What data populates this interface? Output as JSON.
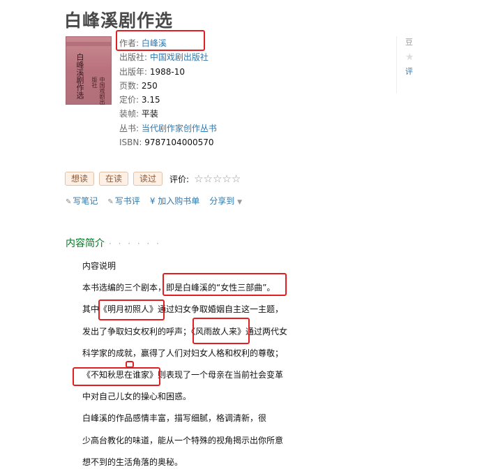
{
  "book": {
    "title": "白峰溪剧作选",
    "cover": {
      "title": "白峰溪剧作选",
      "subtitle": "中国戏剧出版社"
    },
    "info": [
      {
        "label": "作者:",
        "value": "白峰溪",
        "link": true
      },
      {
        "label": "出版社:",
        "value": "中国戏剧出版社",
        "link": true
      },
      {
        "label": "出版年:",
        "value": "1988-10",
        "link": false
      },
      {
        "label": "页数:",
        "value": "250",
        "link": false
      },
      {
        "label": "定价:",
        "value": "3.15",
        "link": false
      },
      {
        "label": "装帧:",
        "value": "平装",
        "link": false
      },
      {
        "label": "丛书:",
        "value": "当代剧作家创作丛书",
        "link": true
      },
      {
        "label": "ISBN:",
        "value": "9787104000570",
        "link": false
      }
    ]
  },
  "sidebar": {
    "label_top": "豆",
    "label_bottom": "评"
  },
  "actions": {
    "want": "想读",
    "reading": "在读",
    "read": "读过",
    "rating_label": "评价:",
    "stars": "☆☆☆☆☆"
  },
  "links": {
    "note": "写笔记",
    "review": "写书评",
    "cart": "¥ 加入购书单",
    "share": "分享到"
  },
  "content": {
    "heading": "内容简介",
    "dots": "· · · · · ·",
    "lines": [
      "内容说明",
      "本书选编的三个剧本，即是白峰溪的“女性三部曲”。",
      "其中《明月初照人》通过妇女争取婚姻自主这一主题，",
      "发出了争取妇女权利的呼声；《风雨故人来》通过两代女",
      "科学家的成就，赢得了人们对妇女人格和权利的尊敬；",
      "《不知秋思在谁家》则表现了一个母亲在当前社会变革",
      "中对自己儿女的操心和困惑。",
      "白峰溪的作品感情丰富，描写细腻，格调清新，很",
      "少高台教化的味道，能从一个特殊的视角揭示出你所意",
      "想不到的生活角落的奥秘。"
    ]
  },
  "colors": {
    "link": "#3377aa",
    "heading_green": "#007722",
    "highlight_red": "#e02020",
    "button_bg": "#fff0e5"
  }
}
